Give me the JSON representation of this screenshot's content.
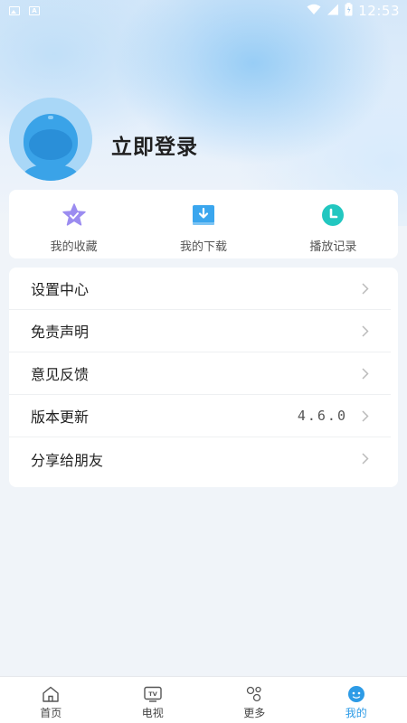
{
  "status_bar": {
    "time": "12:53",
    "left_icons": [
      "image-icon",
      "a-icon"
    ],
    "right_icons": [
      "wifi-icon",
      "signal-icon",
      "battery-icon"
    ]
  },
  "profile": {
    "login_text": "立即登录",
    "avatar_icon": "robot-avatar-icon"
  },
  "quick_actions": [
    {
      "label": "我的收藏",
      "icon": "star-icon",
      "color": "#9b8cf0"
    },
    {
      "label": "我的下载",
      "icon": "download-icon",
      "color": "#3aa6ee"
    },
    {
      "label": "播放记录",
      "icon": "clock-icon",
      "color": "#22c7c0"
    }
  ],
  "menu": {
    "items": [
      {
        "label": "设置中心",
        "value": ""
      },
      {
        "label": "免责声明",
        "value": ""
      },
      {
        "label": "意见反馈",
        "value": ""
      },
      {
        "label": "版本更新",
        "value": "4.6.0"
      },
      {
        "label": "分享给朋友",
        "value": ""
      }
    ]
  },
  "bottom_nav": {
    "items": [
      {
        "label": "首页",
        "icon": "home-icon",
        "active": false
      },
      {
        "label": "电视",
        "icon": "tv-icon",
        "active": false
      },
      {
        "label": "更多",
        "icon": "more-icon",
        "active": false
      },
      {
        "label": "我的",
        "icon": "profile-face-icon",
        "active": true
      }
    ]
  },
  "colors": {
    "accent": "#2d9be6",
    "background": "#f0f4f9"
  }
}
